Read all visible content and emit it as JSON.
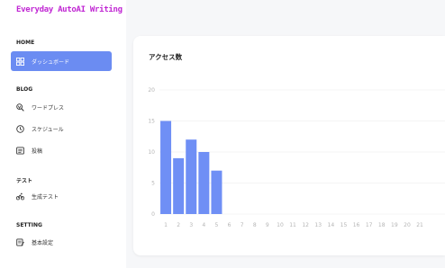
{
  "app": {
    "title": "Everyday AutoAI Writing"
  },
  "sidebar": {
    "sections": [
      {
        "title": "HOME",
        "items": [
          {
            "label": "ダッシュボード",
            "icon": "dashboard-icon",
            "active": true
          }
        ]
      },
      {
        "title": "BLOG",
        "items": [
          {
            "label": "ワードプレス",
            "icon": "wordpress-icon",
            "active": false
          },
          {
            "label": "スケジュール",
            "icon": "clock-icon",
            "active": false
          },
          {
            "label": "投稿",
            "icon": "post-icon",
            "active": false
          }
        ]
      },
      {
        "title": "テスト",
        "items": [
          {
            "label": "生成テスト",
            "icon": "bike-icon",
            "active": false
          }
        ]
      },
      {
        "title": "SETTING",
        "items": [
          {
            "label": "基本設定",
            "icon": "settings-icon",
            "active": false
          }
        ]
      }
    ]
  },
  "main": {
    "card_title": "アクセス数"
  },
  "colors": {
    "accent": "#6b8cf2",
    "bar": "#6f8ff5",
    "logo": "#c026d3"
  },
  "chart_data": {
    "type": "bar",
    "title": "アクセス数",
    "categories": [
      "1",
      "2",
      "3",
      "4",
      "5",
      "6",
      "7",
      "8",
      "9",
      "10",
      "11",
      "12",
      "13",
      "14",
      "15",
      "16",
      "17",
      "18",
      "19",
      "20",
      "21"
    ],
    "values": [
      15,
      9,
      12,
      10,
      7,
      0,
      0,
      0,
      0,
      0,
      0,
      0,
      0,
      0,
      0,
      0,
      0,
      0,
      0,
      0,
      0
    ],
    "y_ticks": [
      "0",
      "5",
      "10",
      "15",
      "20"
    ],
    "ylim": [
      0,
      20
    ],
    "grid": true
  }
}
